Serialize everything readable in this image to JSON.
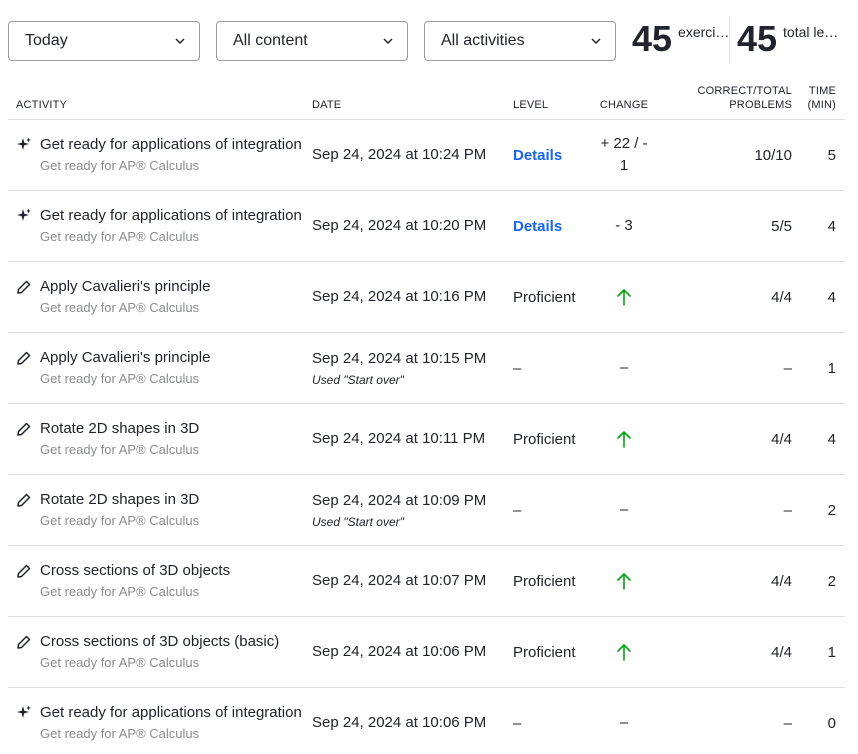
{
  "filters": {
    "time": "Today",
    "content": "All content",
    "activities": "All activities"
  },
  "stats": [
    {
      "value": "45",
      "label": "exercise min"
    },
    {
      "value": "45",
      "label": "total learning min"
    }
  ],
  "table": {
    "headers": {
      "activity": "ACTIVITY",
      "date": "DATE",
      "level": "LEVEL",
      "change": "CHANGE",
      "correct": "CORRECT/TOTAL PROBLEMS",
      "time": "TIME (MIN)"
    },
    "rows": [
      {
        "icon": "sparkle-icon",
        "title": "Get ready for applications of integration",
        "subtitle": "Get ready for AP® Calculus",
        "date": "Sep 24, 2024 at 10:24 PM",
        "note": "",
        "level": "Details",
        "level_link": true,
        "change": "+ 22 / - 1",
        "change_arrow": false,
        "correct": "10/10",
        "time": "5"
      },
      {
        "icon": "sparkle-icon",
        "title": "Get ready for applications of integration",
        "subtitle": "Get ready for AP® Calculus",
        "date": "Sep 24, 2024 at 10:20 PM",
        "note": "",
        "level": "Details",
        "level_link": true,
        "change": "- 3",
        "change_arrow": false,
        "correct": "5/5",
        "time": "4"
      },
      {
        "icon": "pencil-icon",
        "title": "Apply Cavalieri's principle",
        "subtitle": "Get ready for AP® Calculus",
        "date": "Sep 24, 2024 at 10:16 PM",
        "note": "",
        "level": "Proficient",
        "level_link": false,
        "change": "",
        "change_arrow": true,
        "correct": "4/4",
        "time": "4"
      },
      {
        "icon": "pencil-icon",
        "title": "Apply Cavalieri's principle",
        "subtitle": "Get ready for AP® Calculus",
        "date": "Sep 24, 2024 at 10:15 PM",
        "note": "Used \"Start over\"",
        "level": "–",
        "level_link": false,
        "change": "–",
        "change_arrow": false,
        "correct": "–",
        "time": "1"
      },
      {
        "icon": "pencil-icon",
        "title": "Rotate 2D shapes in 3D",
        "subtitle": "Get ready for AP® Calculus",
        "date": "Sep 24, 2024 at 10:11 PM",
        "note": "",
        "level": "Proficient",
        "level_link": false,
        "change": "",
        "change_arrow": true,
        "correct": "4/4",
        "time": "4"
      },
      {
        "icon": "pencil-icon",
        "title": "Rotate 2D shapes in 3D",
        "subtitle": "Get ready for AP® Calculus",
        "date": "Sep 24, 2024 at 10:09 PM",
        "note": "Used \"Start over\"",
        "level": "–",
        "level_link": false,
        "change": "–",
        "change_arrow": false,
        "correct": "–",
        "time": "2"
      },
      {
        "icon": "pencil-icon",
        "title": "Cross sections of 3D objects",
        "subtitle": "Get ready for AP® Calculus",
        "date": "Sep 24, 2024 at 10:07 PM",
        "note": "",
        "level": "Proficient",
        "level_link": false,
        "change": "",
        "change_arrow": true,
        "correct": "4/4",
        "time": "2"
      },
      {
        "icon": "pencil-icon",
        "title": "Cross sections of 3D objects (basic)",
        "subtitle": "Get ready for AP® Calculus",
        "date": "Sep 24, 2024 at 10:06 PM",
        "note": "",
        "level": "Proficient",
        "level_link": false,
        "change": "",
        "change_arrow": true,
        "correct": "4/4",
        "time": "1"
      },
      {
        "icon": "sparkle-icon",
        "title": "Get ready for applications of integration",
        "subtitle": "Get ready for AP® Calculus",
        "date": "Sep 24, 2024 at 10:06 PM",
        "note": "",
        "level": "–",
        "level_link": false,
        "change": "–",
        "change_arrow": false,
        "correct": "–",
        "time": "0"
      }
    ]
  },
  "colors": {
    "link": "#1865f2",
    "up_arrow": "#00a60e",
    "muted": "#8b8c8f"
  }
}
